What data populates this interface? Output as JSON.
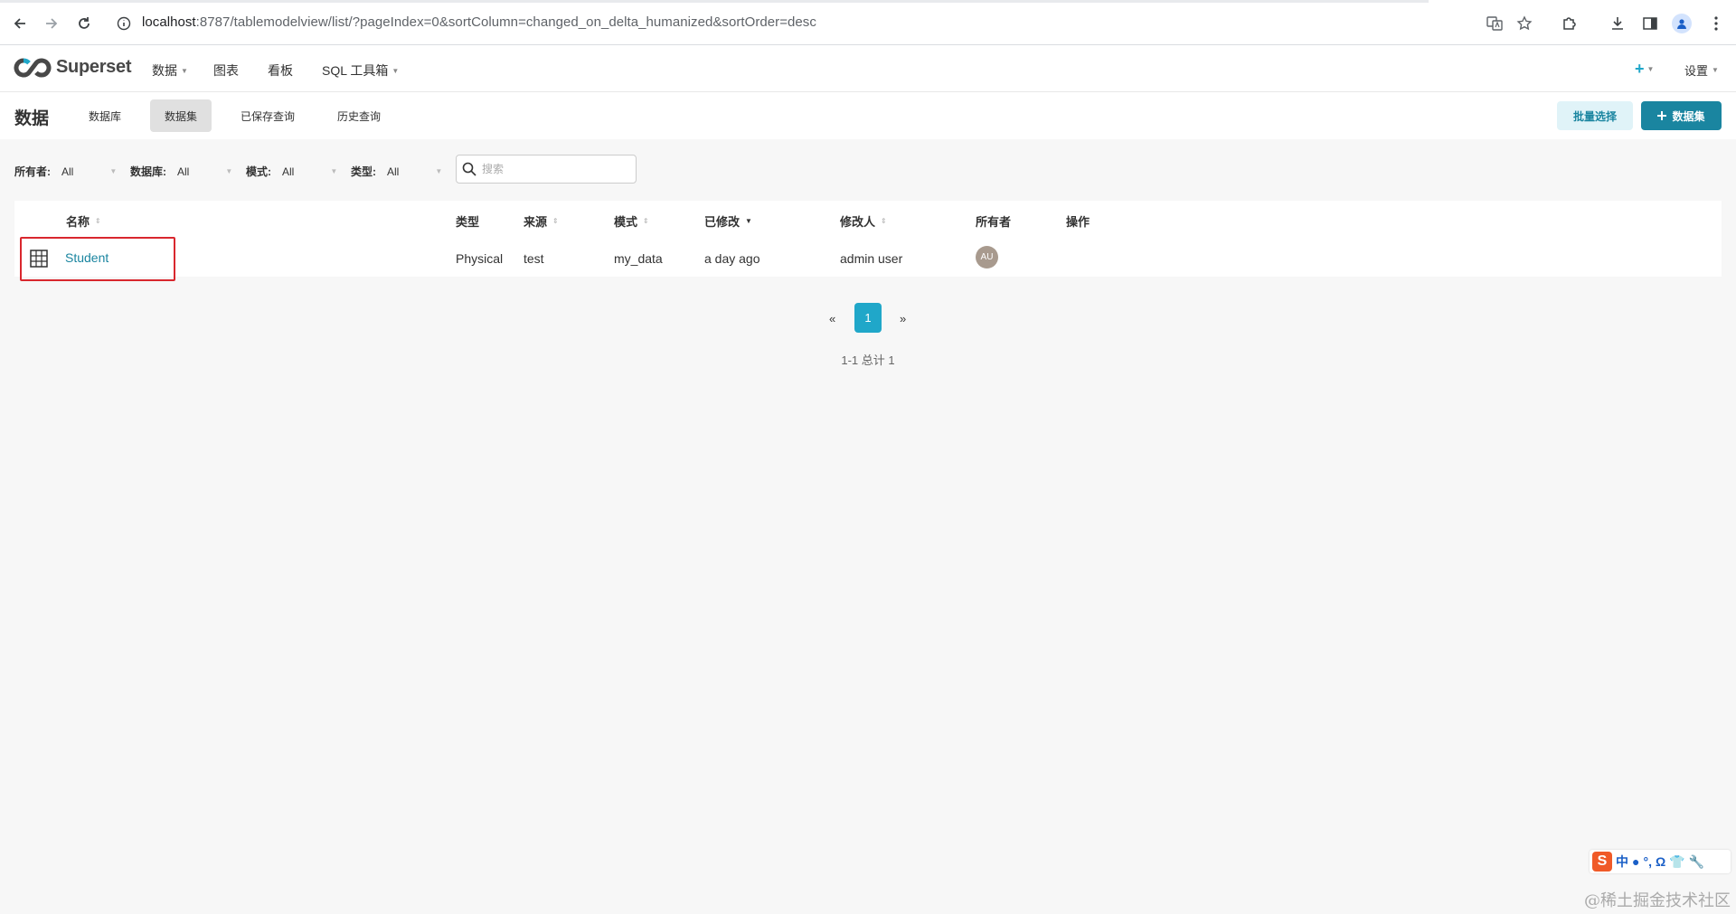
{
  "browser": {
    "url_host": "localhost",
    "url_rest": ":8787/tablemodelview/list/?pageIndex=0&sortColumn=changed_on_delta_humanized&sortOrder=desc"
  },
  "header": {
    "brand": "Superset",
    "menu": [
      {
        "label": "数据",
        "has_caret": true
      },
      {
        "label": "图表",
        "has_caret": false
      },
      {
        "label": "看板",
        "has_caret": false
      },
      {
        "label": "SQL 工具箱",
        "has_caret": true
      }
    ],
    "plus_label": "+",
    "settings_label": "设置"
  },
  "subnav": {
    "title": "数据",
    "tabs": [
      {
        "label": "数据库",
        "active": false
      },
      {
        "label": "数据集",
        "active": true
      },
      {
        "label": "已保存查询",
        "active": false
      },
      {
        "label": "历史查询",
        "active": false
      }
    ],
    "bulk_select_label": "批量选择",
    "add_dataset_label": "数据集"
  },
  "filters": [
    {
      "label": "所有者:",
      "value": "All"
    },
    {
      "label": "数据库:",
      "value": "All"
    },
    {
      "label": "模式:",
      "value": "All"
    },
    {
      "label": "类型:",
      "value": "All"
    }
  ],
  "search": {
    "placeholder": "搜索",
    "value": ""
  },
  "table": {
    "columns": [
      "名称",
      "类型",
      "来源",
      "模式",
      "已修改",
      "修改人",
      "所有者",
      "操作"
    ],
    "sorted_column": "已修改",
    "rows": [
      {
        "name": "Student",
        "type": "Physical",
        "source": "test",
        "schema": "my_data",
        "modified": "a day ago",
        "modified_by": "admin user",
        "owner_initials": "AU"
      }
    ]
  },
  "pagination": {
    "prev": "«",
    "current": "1",
    "next": "»",
    "info": "1-1 总计 1"
  },
  "ime": {
    "glyphs": [
      "中",
      "●",
      "°,",
      "Ω",
      "👕",
      "🔧"
    ]
  },
  "watermark": "@稀土掘金技术社区",
  "colors": {
    "primary": "#20a7c9",
    "primary_dark": "#1a85a0",
    "highlight_box": "#d9272e",
    "background": "#f7f7f7"
  }
}
